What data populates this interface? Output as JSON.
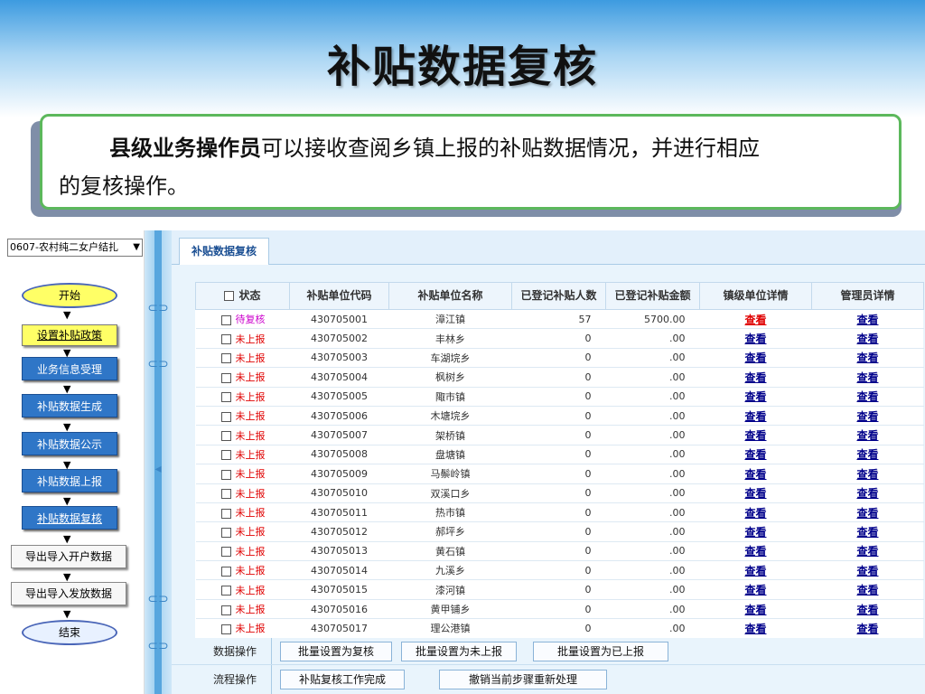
{
  "slide": {
    "title": "补贴数据复核",
    "desc_bold": "县级业务操作员",
    "desc_line1": "可以接收查阅乡镇上报的补贴数据情况，并进行相应",
    "desc_line2": "的复核操作。"
  },
  "flow": {
    "select_value": "0607-农村纯二女户结扎",
    "start": "开始",
    "end": "结束",
    "steps": [
      "设置补贴政策",
      "业务信息受理",
      "补贴数据生成",
      "补贴数据公示",
      "补贴数据上报",
      "补贴数据复核",
      "导出导入开户数据",
      "导出导入发放数据"
    ]
  },
  "tab": {
    "label": "补贴数据复核"
  },
  "table": {
    "headers": [
      "状态",
      "补贴单位代码",
      "补贴单位名称",
      "已登记补贴人数",
      "已登记补贴金额",
      "镇级单位详情",
      "管理员详情"
    ],
    "link_text": "查看",
    "rows": [
      {
        "status": "待复核",
        "code": "430705001",
        "name": "漳江镇",
        "count": "57",
        "amount": "5700.00"
      },
      {
        "status": "未上报",
        "code": "430705002",
        "name": "丰林乡",
        "count": "0",
        "amount": ".00"
      },
      {
        "status": "未上报",
        "code": "430705003",
        "name": "车湖垸乡",
        "count": "0",
        "amount": ".00"
      },
      {
        "status": "未上报",
        "code": "430705004",
        "name": "枫树乡",
        "count": "0",
        "amount": ".00"
      },
      {
        "status": "未上报",
        "code": "430705005",
        "name": "陬市镇",
        "count": "0",
        "amount": ".00"
      },
      {
        "status": "未上报",
        "code": "430705006",
        "name": "木塘垸乡",
        "count": "0",
        "amount": ".00"
      },
      {
        "status": "未上报",
        "code": "430705007",
        "name": "架桥镇",
        "count": "0",
        "amount": ".00"
      },
      {
        "status": "未上报",
        "code": "430705008",
        "name": "盘塘镇",
        "count": "0",
        "amount": ".00"
      },
      {
        "status": "未上报",
        "code": "430705009",
        "name": "马鬃岭镇",
        "count": "0",
        "amount": ".00"
      },
      {
        "status": "未上报",
        "code": "430705010",
        "name": "双溪口乡",
        "count": "0",
        "amount": ".00"
      },
      {
        "status": "未上报",
        "code": "430705011",
        "name": "热市镇",
        "count": "0",
        "amount": ".00"
      },
      {
        "status": "未上报",
        "code": "430705012",
        "name": "郝坪乡",
        "count": "0",
        "amount": ".00"
      },
      {
        "status": "未上报",
        "code": "430705013",
        "name": "黄石镇",
        "count": "0",
        "amount": ".00"
      },
      {
        "status": "未上报",
        "code": "430705014",
        "name": "九溪乡",
        "count": "0",
        "amount": ".00"
      },
      {
        "status": "未上报",
        "code": "430705015",
        "name": "漆河镇",
        "count": "0",
        "amount": ".00"
      },
      {
        "status": "未上报",
        "code": "430705016",
        "name": "黄甲铺乡",
        "count": "0",
        "amount": ".00"
      },
      {
        "status": "未上报",
        "code": "430705017",
        "name": "理公港镇",
        "count": "0",
        "amount": ".00"
      }
    ]
  },
  "ops": {
    "data_label": "数据操作",
    "flow_label": "流程操作",
    "batch_review": "批量设置为复核",
    "batch_unreported": "批量设置为未上报",
    "batch_reported": "批量设置为已上报",
    "review_done": "补贴复核工作完成",
    "undo_step": "撤销当前步骤重新处理"
  },
  "colors": {
    "pending_status": "#cc00cc",
    "unreported_status": "#e00000",
    "link": "#00008b",
    "flow_blue": "#2f76c7",
    "flow_yellow": "#ffff66",
    "frame_green": "#5cb85c"
  }
}
